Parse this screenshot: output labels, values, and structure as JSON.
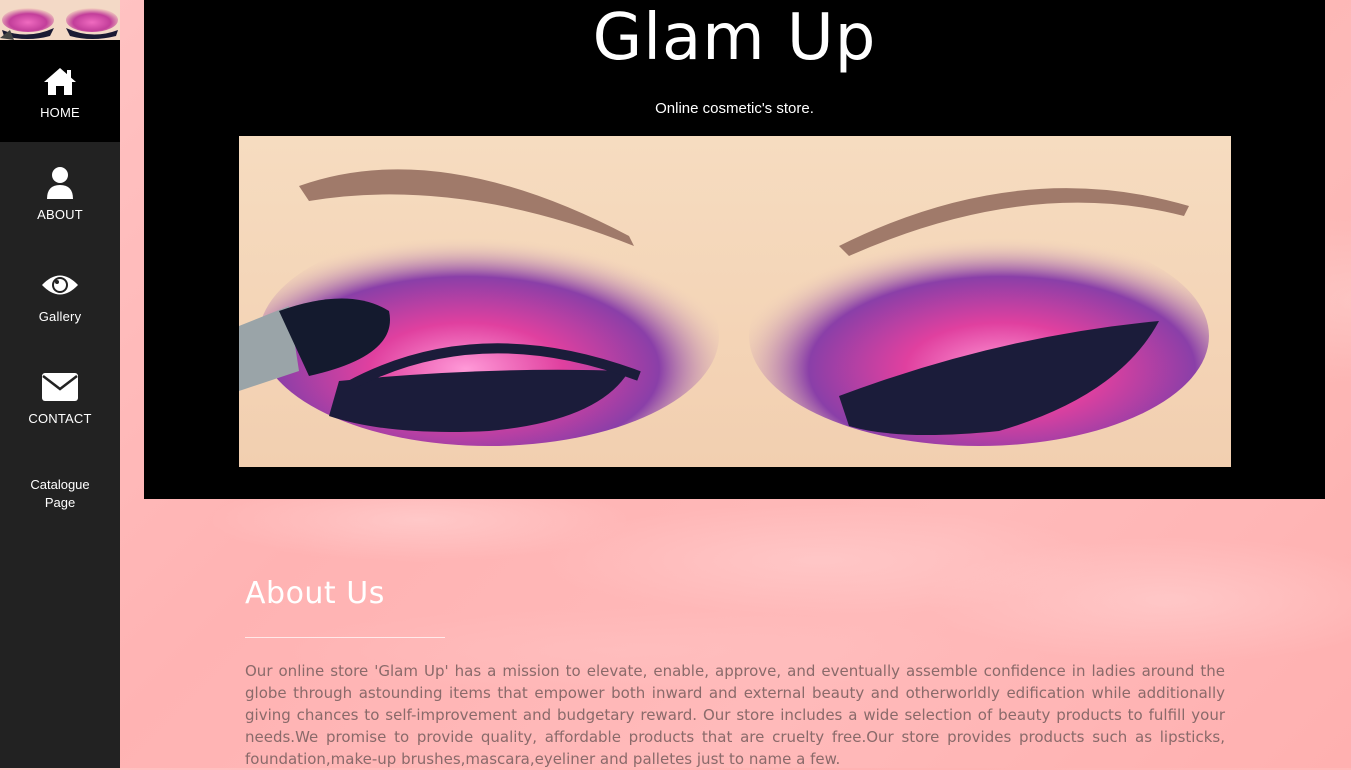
{
  "sidebar": {
    "items": [
      {
        "label": "HOME",
        "icon": "home-icon"
      },
      {
        "label": "ABOUT",
        "icon": "user-icon"
      },
      {
        "label": "Gallery",
        "icon": "eye-icon"
      },
      {
        "label": "CONTACT",
        "icon": "envelope-icon"
      }
    ],
    "catalogue_line1": "Catalogue",
    "catalogue_line2": "Page"
  },
  "header": {
    "title": "Glam Up",
    "subtitle": "Online cosmetic's store."
  },
  "about": {
    "title": "About Us",
    "text": "Our online store 'Glam Up' has a mission to elevate, enable, approve, and eventually assemble confidence in ladies around the globe through astounding items that empower both inward and external beauty and otherworldly edification while additionally giving chances to self-improvement and budgetary reward. Our store includes a wide selection of beauty products to fulfill your needs.We promise to provide quality, affordable products that are cruelty free.Our store provides products such as lipsticks, foundation,make-up brushes,mascara,eyeliner and palletes just to name a few."
  },
  "colors": {
    "sidebar_bg": "#222222",
    "active_bg": "#000000",
    "page_bg": "#ffb8b8",
    "header_bg": "#000000"
  }
}
